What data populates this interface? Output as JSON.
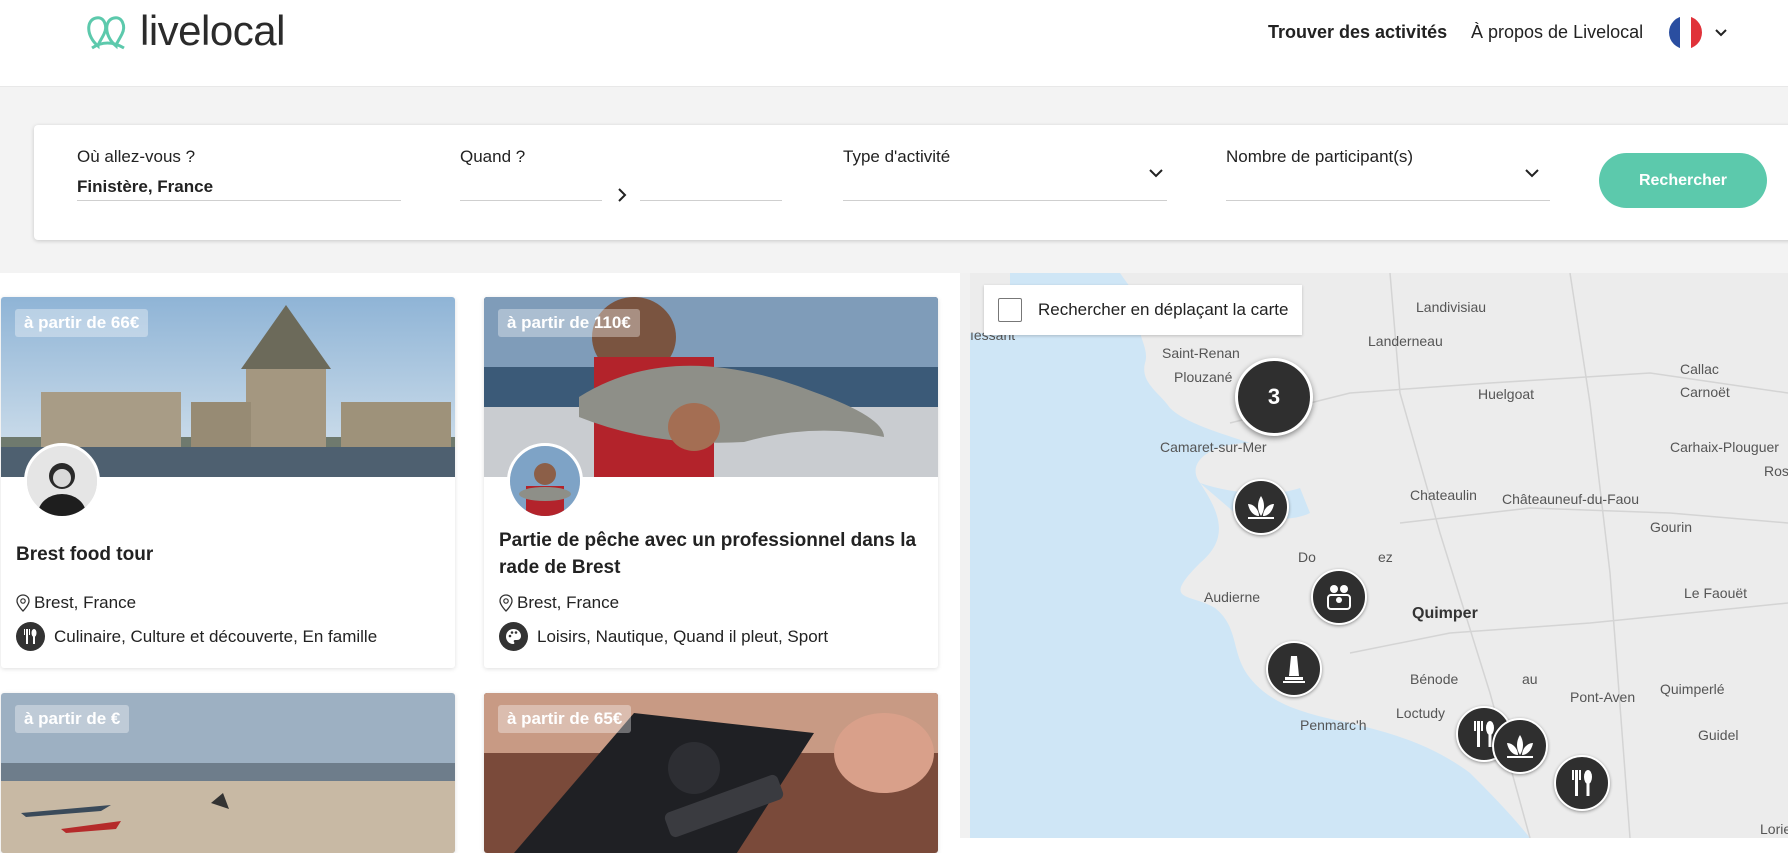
{
  "brand": {
    "name": "livelocal",
    "accent": "#5cc9ac"
  },
  "nav": {
    "find": "Trouver des activités",
    "about": "À propos de Livelocal",
    "language_flag": "flag-fr-icon"
  },
  "search": {
    "where_label": "Où allez-vous ?",
    "where_value": "Finistère, France",
    "when_label": "Quand ?",
    "type_label": "Type d'activité",
    "participants_label": "Nombre de participant(s)",
    "button": "Rechercher"
  },
  "cards": [
    {
      "price": "à partir de 66€",
      "title": "Brest food tour",
      "location": "Brest, France",
      "categories": "Culinaire, Culture et découverte, En famille",
      "category_icon": "fork-knife-icon"
    },
    {
      "price": "à partir de 110€",
      "title": "Partie de pêche avec un professionnel dans la rade de Brest",
      "location": "Brest, France",
      "categories": "Loisirs, Nautique, Quand il pleut, Sport",
      "category_icon": "palette-icon"
    },
    {
      "price": "à partir de €"
    },
    {
      "price": "à partir de 65€"
    }
  ],
  "map": {
    "search_on_move": "Rechercher en déplaçant la carte",
    "places": [
      "Landivisiau",
      "ıessant",
      "Landerneau",
      "Saint-Renan",
      "Plouzané",
      "Callac",
      "Huelgoat",
      "Carnoët",
      "Camaret-sur-Mer",
      "Carhaix-Plouguer",
      "Ros",
      "Chateaulin",
      "Châteauneuf-du-Faou",
      "Gourin",
      "Do",
      "ez",
      "Le Faouët",
      "Audierne",
      "Quimper",
      "Bénode",
      "au",
      "Pont-Aven",
      "Quimperlé",
      "Loctudy",
      "Penmarc'h",
      "Guidel",
      "Lorie"
    ],
    "cluster_count": "3",
    "markers": [
      "lotus-icon",
      "family-icon",
      "monument-icon",
      "fork-knife-icon",
      "lotus-icon",
      "fork-knife-icon"
    ]
  }
}
